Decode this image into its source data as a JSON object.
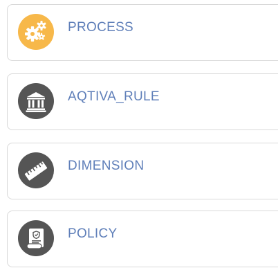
{
  "colors": {
    "label": "#5f7fb9",
    "card_border": "#d9d9d9",
    "process_icon_bg": "#f7b84a",
    "default_icon_bg": "#555555",
    "icon_fg": "#ffffff"
  },
  "items": [
    {
      "label": "PROCESS",
      "icon": "gears-icon"
    },
    {
      "label": "AQTIVA_RULE",
      "icon": "bank-icon"
    },
    {
      "label": "DIMENSION",
      "icon": "ruler-icon"
    },
    {
      "label": "POLICY",
      "icon": "certificate-icon"
    }
  ]
}
